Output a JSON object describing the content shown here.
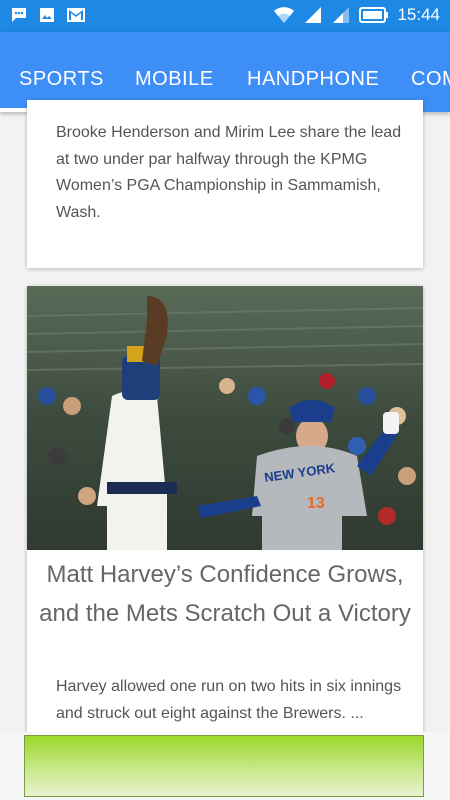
{
  "status_bar": {
    "time": "15:44",
    "left_icons": [
      "chat-notification-icon",
      "image-notification-icon",
      "gmail-icon"
    ],
    "right_icons": [
      "wifi-icon",
      "signal-icon",
      "signal-icon-2",
      "battery-icon"
    ]
  },
  "tabs": [
    {
      "label": "SPORTS",
      "active": true
    },
    {
      "label": "MOBILE",
      "active": false
    },
    {
      "label": "HANDPHONE",
      "active": false
    },
    {
      "label": "COM",
      "active": false
    }
  ],
  "articles": [
    {
      "summary": "Brooke Henderson and Mirim Lee share the lead at two under par halfway through the KPMG Women’s PGA Championship in Sammamish, Wash."
    },
    {
      "image": "baseball-photo",
      "jersey_text": "NEW YORK",
      "jersey_number": "13",
      "headline": "Matt Harvey’s Confidence Grows, and the Mets Scratch Out a Victory",
      "summary": "Harvey allowed one run on two hits in six innings and struck out eight against the Brewers. ..."
    }
  ],
  "colors": {
    "status_bar": "#1e88e5",
    "tab_bar": "#3e8ef7",
    "ad_banner": "#9bd82a"
  }
}
